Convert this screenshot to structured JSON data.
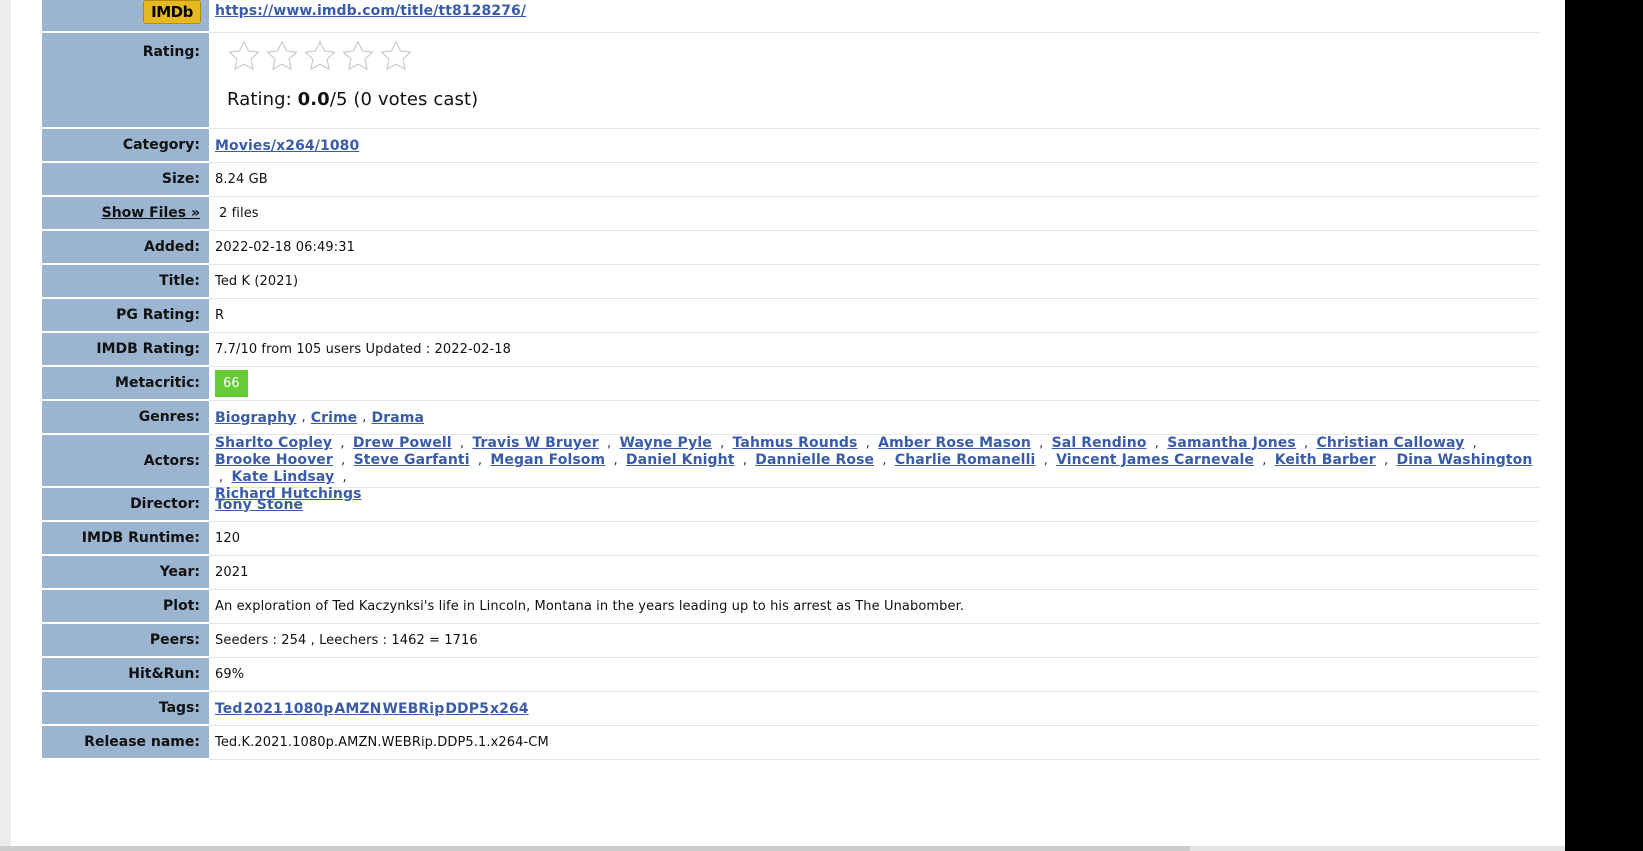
{
  "imdb": {
    "logo_text": "IMDb",
    "url": "https://www.imdb.com/title/tt8128276/"
  },
  "rating": {
    "label": "Rating:",
    "prefix": "Rating: ",
    "value": "0.0",
    "suffix": "/5 (0 votes cast)",
    "stars": 5,
    "filled": 0
  },
  "category": {
    "label": "Category:",
    "value": "Movies/x264/1080"
  },
  "size": {
    "label": "Size:",
    "value": "8.24 GB"
  },
  "files": {
    "label": "Show Files »",
    "value": "2 files"
  },
  "added": {
    "label": "Added:",
    "value": "2022-02-18 06:49:31"
  },
  "title": {
    "label": "Title:",
    "value": "Ted K (2021)"
  },
  "pg_rating": {
    "label": "PG Rating:",
    "value": "R"
  },
  "imdb_rating": {
    "label": "IMDB Rating:",
    "value": "7.7/10 from 105 users Updated : 2022-02-18"
  },
  "metacritic": {
    "label": "Metacritic:",
    "value": "66",
    "color": "#66cc33"
  },
  "genres": {
    "label": "Genres:",
    "items": [
      "Biography",
      "Crime",
      "Drama"
    ]
  },
  "actors": {
    "label": "Actors:",
    "items": [
      "Sharlto Copley",
      "Drew Powell",
      "Travis W Bruyer",
      "Wayne Pyle",
      "Tahmus Rounds",
      "Amber Rose Mason",
      "Sal Rendino",
      "Samantha Jones",
      "Christian Calloway",
      "Brooke Hoover",
      "Steve Garfanti",
      "Megan Folsom",
      "Daniel Knight",
      "Dannielle Rose",
      "Charlie Romanelli",
      "Vincent James Carnevale",
      "Keith Barber",
      "Dina Washington",
      "Kate Lindsay",
      "Richard Hutchings"
    ]
  },
  "director": {
    "label": "Director:",
    "value": "Tony Stone"
  },
  "runtime": {
    "label": "IMDB Runtime:",
    "value": "120"
  },
  "year": {
    "label": "Year:",
    "value": "2021"
  },
  "plot": {
    "label": "Plot:",
    "value": "An exploration of Ted Kaczynksi's life in Lincoln, Montana in the years leading up to his arrest as The Unabomber."
  },
  "peers": {
    "label": "Peers:",
    "value": "Seeders : 254 , Leechers : 1462 = 1716"
  },
  "hitrun": {
    "label": "Hit&Run:",
    "value": "69%"
  },
  "tags": {
    "label": "Tags:",
    "items": [
      "Ted",
      "2021",
      "1080p",
      "AMZN",
      "WEBRip",
      "DDP5",
      "x264"
    ]
  },
  "release": {
    "label": "Release name:",
    "value": "Ted.K.2021.1080p.AMZN.WEBRip.DDP5.1.x264-CM"
  },
  "colors": {
    "label_bg": "#9bb4cf",
    "link": "#3a5ca8",
    "metacritic": "#66cc33"
  }
}
